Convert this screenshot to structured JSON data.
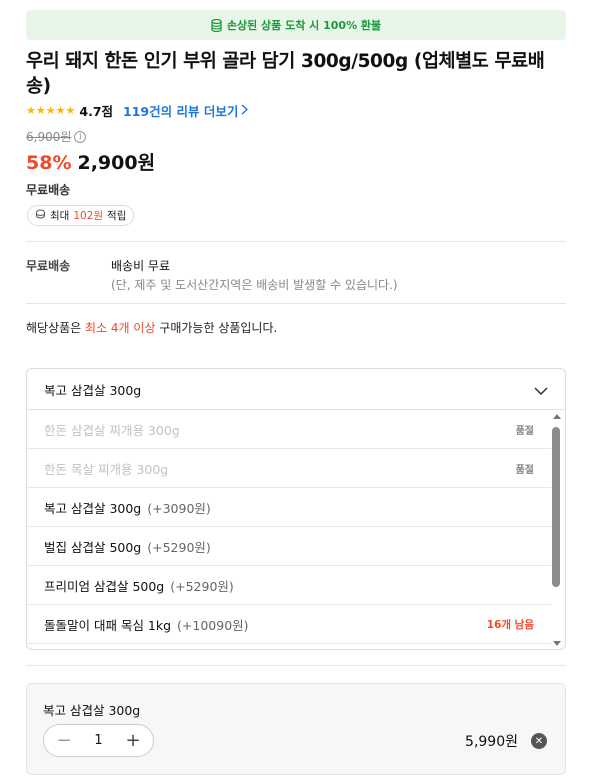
{
  "banner": {
    "text": "손상된 상품 도착 시 100% 환불",
    "icon": "coin-stack-icon"
  },
  "product": {
    "title": "우리 돼지 한돈 인기 부위 골라 담기 300g/500g (업체별도 무료배송)",
    "rating": 5,
    "rating_score": "4.7점",
    "review_link": "119건의 리뷰 더보기",
    "original_price": "6,900원",
    "discount": "58%",
    "sale_price": "2,900원",
    "shipping_label": "무료배송",
    "points": {
      "prefix": "최대 ",
      "amount": "102원",
      "suffix": " 적립"
    }
  },
  "shipping": {
    "label": "무료배송",
    "fee": "배송비 무료",
    "note": "(단, 제주 및 도서산간지역은 배송비 발생할 수 있습니다.)"
  },
  "min_qty": {
    "prefix": "해당상품은 ",
    "highlight": "최소 4개 이상",
    "suffix": " 구매가능한 상품입니다."
  },
  "option_select": {
    "selected": "복고 삼겹살 300g",
    "options": [
      {
        "name": "한돈 삼겹살 찌개용 300g",
        "extra": "",
        "status": "품절",
        "soldout": true
      },
      {
        "name": "한돈 목살 찌개용 300g",
        "extra": "",
        "status": "품절",
        "soldout": true
      },
      {
        "name": "복고 삼겹살 300g",
        "extra": "(+3090원)",
        "status": "",
        "soldout": false
      },
      {
        "name": "벌집 삼겹살 500g",
        "extra": "(+5290원)",
        "status": "",
        "soldout": false
      },
      {
        "name": "프리미엄 삼겹살 500g",
        "extra": "(+5290원)",
        "status": "",
        "soldout": false
      },
      {
        "name": "돌돌말이 대패 목심 1kg",
        "extra": "(+10090원)",
        "status": "16개 남음",
        "soldout": false
      }
    ]
  },
  "selected_item": {
    "name": "복고 삼겹살 300g",
    "quantity": "1",
    "minus": "−",
    "plus": "+",
    "price": "5,990원",
    "remove": "✕"
  },
  "colors": {
    "accent": "#f04a2a",
    "link": "#1d76db",
    "green": "#1a9a3a",
    "star": "#ffb400"
  }
}
